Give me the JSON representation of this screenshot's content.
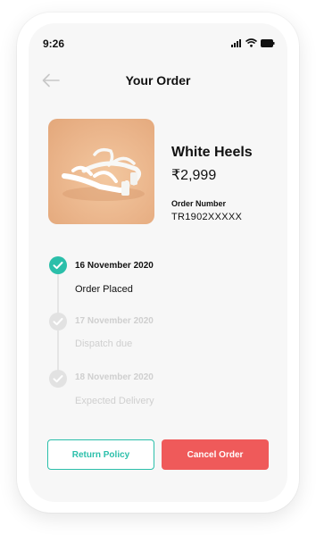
{
  "status_bar": {
    "time": "9:26",
    "icons": [
      "signal-icon",
      "wifi-icon",
      "battery-icon"
    ]
  },
  "header": {
    "title": "Your Order",
    "back_icon": "arrow-left-icon"
  },
  "product": {
    "name": "White Heels",
    "price": "₹2,999",
    "order_number_label": "Order Number",
    "order_number": "TR1902XXXXX",
    "image_icon": "white-heels-image"
  },
  "timeline": [
    {
      "date": "16 November 2020",
      "label": "Order Placed",
      "status": "done"
    },
    {
      "date": "17 November 2020",
      "label": "Dispatch due",
      "status": "pending"
    },
    {
      "date": "18 November 2020",
      "label": "Expected Delivery",
      "status": "pending"
    }
  ],
  "actions": {
    "return_label": "Return Policy",
    "cancel_label": "Cancel Order"
  },
  "colors": {
    "accent": "#2bbfaa",
    "danger": "#ef5a5a",
    "muted": "#cfcfcf"
  }
}
